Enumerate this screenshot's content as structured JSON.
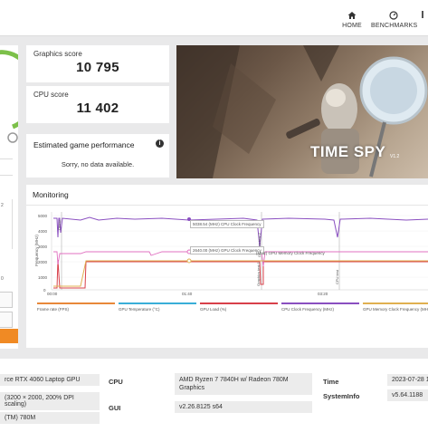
{
  "nav": {
    "home": "HOME",
    "benchmarks": "BENCHMARKS"
  },
  "graphics": {
    "label": "Graphics score",
    "value": "10 795"
  },
  "cpu": {
    "label": "CPU score",
    "value": "11 402"
  },
  "estimated": {
    "label": "Estimated game performance",
    "message": "Sorry, no data available."
  },
  "hero": {
    "title": "TIME SPY",
    "version": "V1.2"
  },
  "monitoring": {
    "title": "Monitoring",
    "y_axis_label": "Frequency (MHz)",
    "y_ticks": [
      "5000",
      "4000",
      "3000",
      "2000",
      "1000",
      "0"
    ],
    "x_ticks": [
      "00:00",
      "01:40",
      "03:20"
    ],
    "markers": [
      "Demo",
      "Graphics test 1",
      "Graphics test 2",
      "CPU test"
    ],
    "tooltips": [
      "5038.54 (MHz) CPU Clock Frequency",
      "2640.00 (MHz) GPU Clock Frequency",
      "(MHz) GPU Memory Clock Frequency"
    ],
    "legend": [
      {
        "label": "Frame rate (FPS)",
        "color": "#e8883a"
      },
      {
        "label": "GPU Temperature (°C)",
        "color": "#3aaed8"
      },
      {
        "label": "GPU Load (%)",
        "color": "#d8404a"
      },
      {
        "label": "CPU Clock Frequency (MHz)",
        "color": "#8a4fc0"
      },
      {
        "label": "GPU Memory Clock Frequency (MHz)",
        "color": "#e0b050"
      }
    ]
  },
  "sysinfo": {
    "gpu_value": "rce RTX 4060 Laptop GPU",
    "display_value": "(3200 × 2000, 200% DPI scaling)",
    "igpu_value": "(TM) 780M",
    "cpu_label": "CPU",
    "cpu_value_1": "AMD Ryzen 7 7840H w/ Radeon 780M",
    "cpu_value_2": "Graphics",
    "gui_label": "GUI",
    "gui_value": "v2.26.8125 s64",
    "time_label": "Time",
    "time_value": "2023-07-28 1",
    "sysinfo_label": "SystemInfo",
    "sysinfo_value": "v5.64.1188"
  },
  "left": {
    "ticks": [
      "2",
      "0"
    ]
  }
}
